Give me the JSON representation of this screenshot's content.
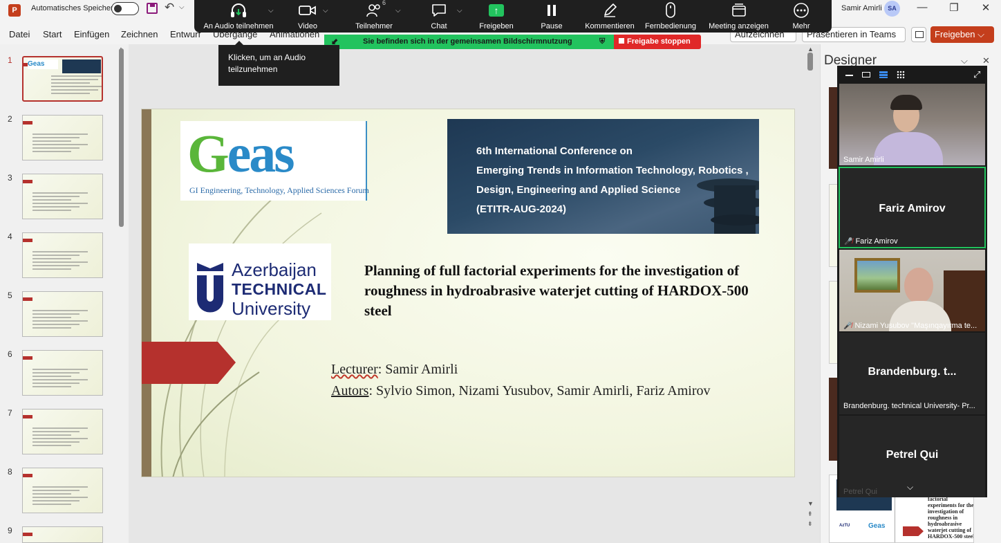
{
  "titlebar": {
    "app_icon": "powerpoint-icon",
    "autosave_label": "Automatisches Speichern",
    "user_name": "Samir Amirli",
    "user_initials": "SA",
    "minimize": "—",
    "restore": "❐",
    "close": "✕"
  },
  "ribbon": {
    "tabs": [
      "Datei",
      "Start",
      "Einfügen",
      "Zeichnen",
      "Entwurf",
      "Übergänge",
      "Animationen"
    ],
    "record_label": "Aufzeichnen",
    "teams_label": "Präsentieren in Teams",
    "share_label": "Freigeben"
  },
  "zoom_toolbar": {
    "items": [
      {
        "label": "An Audio teilnehmen",
        "icon": "headphones-icon"
      },
      {
        "label": "Video",
        "icon": "video-camera-icon"
      },
      {
        "label": "Teilnehmer",
        "icon": "participants-icon",
        "count": "6"
      },
      {
        "label": "Chat",
        "icon": "chat-icon"
      },
      {
        "label": "Freigeben",
        "icon": "share-screen-icon"
      },
      {
        "label": "Pause",
        "icon": "pause-icon"
      },
      {
        "label": "Kommentieren",
        "icon": "pen-icon"
      },
      {
        "label": "Fernbedienung",
        "icon": "mouse-icon"
      },
      {
        "label": "Meeting anzeigen",
        "icon": "meeting-window-icon"
      },
      {
        "label": "Mehr",
        "icon": "more-icon"
      }
    ],
    "sharing_banner": "Sie befinden sich in der gemeinsamen Bildschirmnutzung",
    "stop_share": "Freigabe stoppen",
    "tooltip": "Klicken, um an Audio teilzunehmen"
  },
  "slide_panel": {
    "numbers": [
      "1",
      "2",
      "3",
      "4",
      "5",
      "6",
      "7",
      "8",
      "9"
    ],
    "active_index": 1
  },
  "slide": {
    "geas_logo_g": "G",
    "geas_logo_rest": "eas",
    "geas_subtitle": "GI Engineering, Technology, Applied Sciences Forum",
    "conference_lines": [
      "6th International Conference on",
      "Emerging Trends in Information Technology, Robotics ,",
      "Design, Engineering and Applied Science",
      "(ETITR-AUG-2024)"
    ],
    "university_lines": [
      "Azerbaijan",
      "TECHNICAL",
      "University"
    ],
    "title": "Planning of full factorial experiments for the investigation of roughness in hydroabrasive waterjet cutting of HARDOX-500 steel",
    "lecturer_label": "Lecturer",
    "lecturer_value": ": Samir  Amirli",
    "authors_label": "Autors",
    "authors_value": ": Sylvio Simon, Nizami Yusubov, Samir Amirli, Fariz Amirov"
  },
  "designer": {
    "title": "Designer",
    "thumb_caption": "factorial experiments for the investigation of roughness in hydroabrasive waterjet cutting of HARDOX-500 steel"
  },
  "gallery": {
    "participants": [
      {
        "name": "Samir Amirli",
        "label": "Samir Amirli",
        "video": true,
        "muted": false
      },
      {
        "name": "Fariz Amirov",
        "label": "Fariz Amirov",
        "video": false,
        "muted": true,
        "active": true
      },
      {
        "name": "Nizami Yusubov",
        "label": "Nizami Yusubov \"Maşınqayırma te...",
        "video": true,
        "muted": true
      },
      {
        "name": "Brandenburg. t...",
        "label": "Brandenburg. technical University- Pr...",
        "video": false,
        "muted": false
      },
      {
        "name": "Petrel Qui",
        "label": "Petrel Qui",
        "video": false,
        "muted": false
      }
    ]
  },
  "colors": {
    "accent_red": "#c43e1c",
    "zoom_green": "#22c35e",
    "stop_red": "#e02828",
    "slide_arrow": "#b5312d"
  }
}
